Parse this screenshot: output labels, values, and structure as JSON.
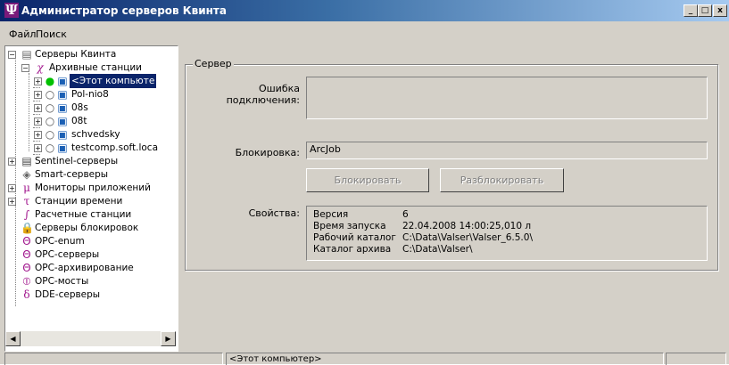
{
  "window": {
    "title": "Администратор серверов Квинта",
    "minimize": "_",
    "maximize": "□",
    "close": "x"
  },
  "menu": [
    {
      "label": "Файл"
    },
    {
      "label": "Поиск"
    }
  ],
  "tree": {
    "root": "Серверы Квинта",
    "archive": "Архивные станции",
    "stations": [
      {
        "label": "<Этот компьюте",
        "status": "online"
      },
      {
        "label": "Pol-nio8",
        "status": "offline"
      },
      {
        "label": "08s",
        "status": "offline"
      },
      {
        "label": "08t",
        "status": "offline"
      },
      {
        "label": "schvedsky",
        "status": "offline"
      },
      {
        "label": "testcomp.soft.loca",
        "status": "offline"
      }
    ],
    "groups": [
      "Sentinel-серверы",
      "Smart-серверы",
      "Мониторы приложений",
      "Станции времени",
      "Расчетные станции",
      "Серверы блокировок",
      "OPC-enum",
      "OPC-серверы",
      "OPC-архивирование",
      "OPC-мосты",
      "DDE-серверы"
    ],
    "scroll_left": "◀",
    "scroll_right": "▶"
  },
  "server": {
    "group_title": "Сервер",
    "error_label": "Ошибка подключения:",
    "error_value": "",
    "lock_label": "Блокировка:",
    "lock_value": "ArcJob",
    "lock_button": "Блокировать",
    "unlock_button": "Разблокировать",
    "props_label": "Свойства:",
    "props": [
      {
        "key": "Версия",
        "value": "6"
      },
      {
        "key": "Время запуска",
        "value": "22.04.2008 14:00:25,010 л"
      },
      {
        "key": "Рабочий каталог",
        "value": "C:\\Data\\Valser\\Valser_6.5.0\\"
      },
      {
        "key": "Каталог архива",
        "value": "C:\\Data\\Valser\\"
      }
    ]
  },
  "status": {
    "text": "<Этот компьютер>"
  },
  "colors": {
    "title_start": "#0a246a",
    "title_end": "#a6caf0",
    "face": "#d4d0c8",
    "online": "#00c000",
    "accent": "#a0148c"
  }
}
